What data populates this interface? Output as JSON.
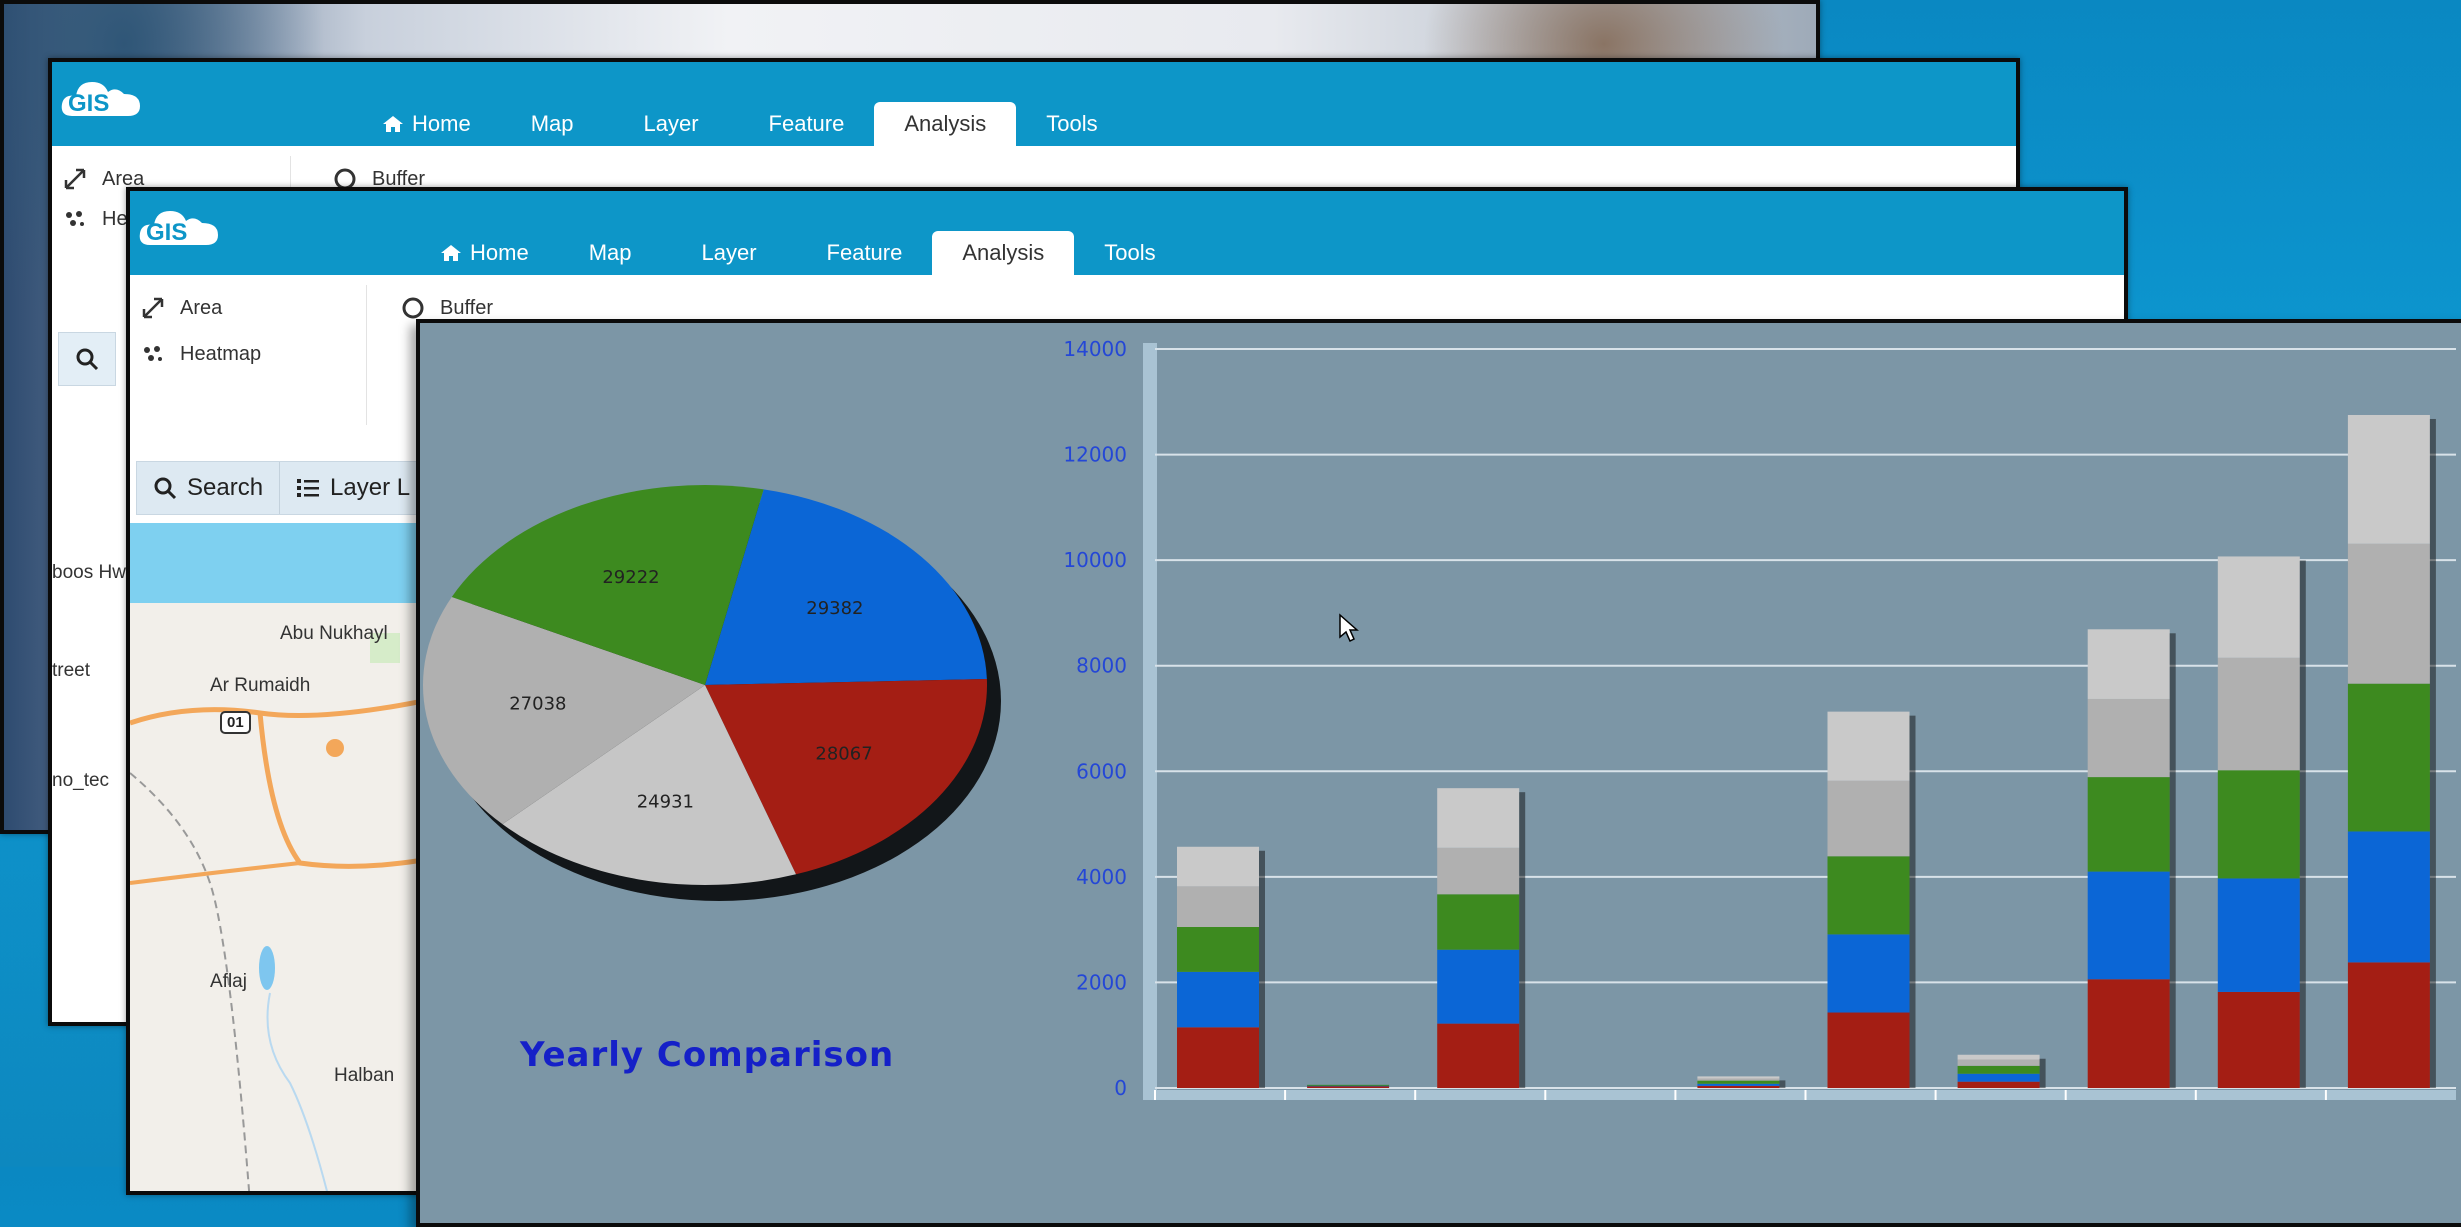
{
  "app": {
    "logo_text": "GIS",
    "tabs": [
      {
        "label": "Home",
        "icon": "home-icon"
      },
      {
        "label": "Map"
      },
      {
        "label": "Layer"
      },
      {
        "label": "Feature"
      },
      {
        "label": "Analysis",
        "active": true
      },
      {
        "label": "Tools"
      }
    ],
    "ribbon": {
      "area": "Area",
      "heatmap": "Heatmap",
      "buffer": "Buffer"
    },
    "toolbar": {
      "search": "Search",
      "layer": "Layer L"
    },
    "map_labels": {
      "abu_nukhayl": "Abu Nukhayl",
      "ar_rumaidh": "Ar Rumaidh",
      "route": "01",
      "aflaj": "Aflaj",
      "halban": "Halban",
      "boos_hwy": "boos Hw",
      "street": "treet",
      "tech": "no_tec"
    }
  },
  "colors": {
    "red": "#a41e14",
    "blue": "#0b66d6",
    "green": "#3d8a1f",
    "grey": "#b0b0b0",
    "light_grey": "#c9c9c9",
    "panel": "#7c96a6",
    "axis_text": "#2447d6"
  },
  "chart_data": [
    {
      "type": "pie",
      "title": "Yearly Comparison",
      "slices": [
        {
          "label": "29382",
          "value": 29382,
          "color": "#0b66d6"
        },
        {
          "label": "28067",
          "value": 28067,
          "color": "#a41e14"
        },
        {
          "label": "24931",
          "value": 24931,
          "color": "#c6c6c6"
        },
        {
          "label": "27038",
          "value": 27038,
          "color": "#b0b0b0"
        },
        {
          "label": "29222",
          "value": 29222,
          "color": "#3d8a1f"
        }
      ]
    },
    {
      "type": "bar",
      "stacked": true,
      "ylim": [
        0,
        14000
      ],
      "yticks": [
        0,
        2000,
        4000,
        6000,
        8000,
        10000,
        12000,
        14000
      ],
      "categories": [
        "",
        "",
        "",
        "",
        "",
        "",
        "",
        "",
        "",
        ""
      ],
      "series": [
        {
          "color": "#a41e14",
          "values": [
            1150,
            40,
            1220,
            0,
            40,
            1430,
            120,
            2060,
            1820,
            2380
          ]
        },
        {
          "color": "#0b66d6",
          "values": [
            1050,
            10,
            1400,
            0,
            40,
            1480,
            150,
            2040,
            2150,
            2480
          ]
        },
        {
          "color": "#3d8a1f",
          "values": [
            850,
            10,
            1050,
            0,
            60,
            1480,
            150,
            1790,
            2050,
            2800
          ]
        },
        {
          "color": "#b0b0b0",
          "values": [
            770,
            0,
            880,
            0,
            40,
            1430,
            120,
            1480,
            2130,
            2650
          ]
        },
        {
          "color": "#c9c9c9",
          "values": [
            750,
            0,
            1130,
            0,
            40,
            1310,
            90,
            1320,
            1920,
            2440
          ]
        }
      ]
    }
  ]
}
